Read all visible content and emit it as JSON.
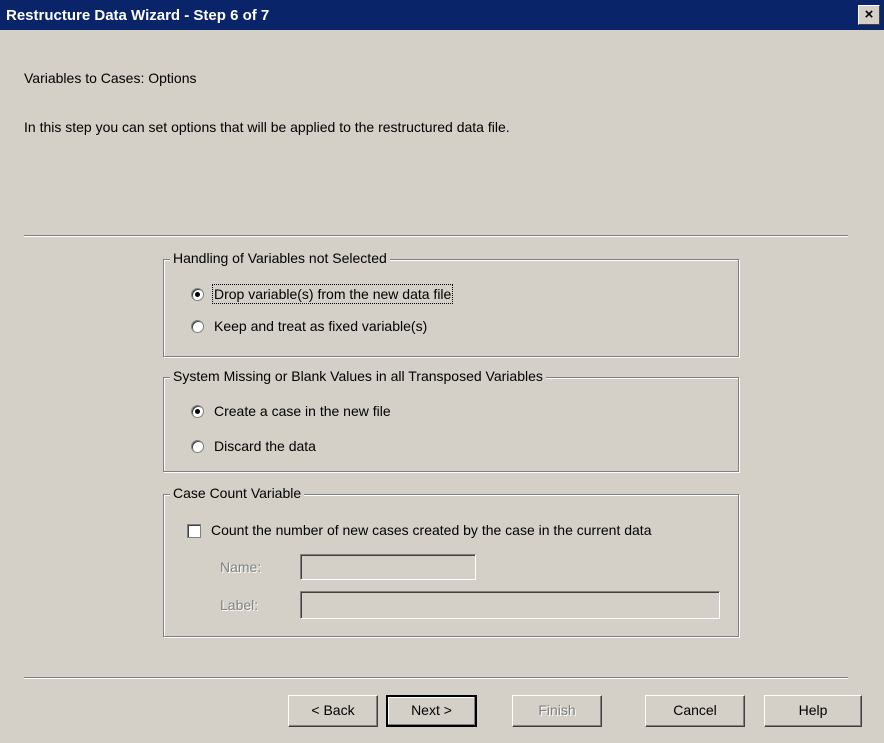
{
  "window": {
    "title": "Restructure Data Wizard - Step 6 of 7",
    "close_glyph": "×"
  },
  "header": {
    "heading": "Variables to Cases: Options",
    "description": "In this step you can set options that will be applied to the restructured data file."
  },
  "groups": {
    "handling": {
      "legend": "Handling of Variables not Selected",
      "options": [
        {
          "label": "Drop variable(s) from the new data file",
          "selected": true
        },
        {
          "label": "Keep and treat as fixed variable(s)",
          "selected": false
        }
      ]
    },
    "missing": {
      "legend": "System Missing or Blank Values in all Transposed Variables",
      "options": [
        {
          "label": "Create a case in the new file",
          "selected": true
        },
        {
          "label": "Discard the data",
          "selected": false
        }
      ]
    },
    "count": {
      "legend": "Case Count Variable",
      "checkbox_label": "Count the number of new cases created by the case in the current data",
      "checked": false,
      "name_label": "Name:",
      "name_value": "",
      "label_label": "Label:",
      "label_value": ""
    }
  },
  "buttons": {
    "back": "< Back",
    "next": "Next >",
    "finish": "Finish",
    "cancel": "Cancel",
    "help": "Help"
  }
}
